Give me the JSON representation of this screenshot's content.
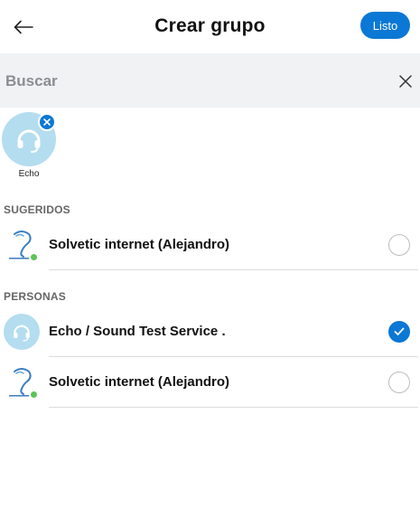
{
  "header": {
    "title": "Crear grupo",
    "done_label": "Listo",
    "back_icon": "arrow-left-icon"
  },
  "search": {
    "placeholder": "Buscar",
    "value": "",
    "clear_icon": "close-icon"
  },
  "selected": [
    {
      "name": "Echo",
      "remove_icon": "close-icon"
    }
  ],
  "sections": {
    "suggested": {
      "label": "SUGERIDOS",
      "items": [
        {
          "name": "Solvetic internet (Alejandro)",
          "checked": false,
          "presence": "online"
        }
      ]
    },
    "people": {
      "label": "PERSONAS",
      "items": [
        {
          "name": "Echo / Sound Test Service .",
          "checked": true
        },
        {
          "name": "Solvetic internet (Alejandro)",
          "checked": false,
          "presence": "online"
        }
      ]
    }
  },
  "colors": {
    "accent": "#0a78d4",
    "presence_online": "#5cc35a",
    "search_bg": "#f1f2f4",
    "echo_avatar_bg": "#b4ddef"
  }
}
